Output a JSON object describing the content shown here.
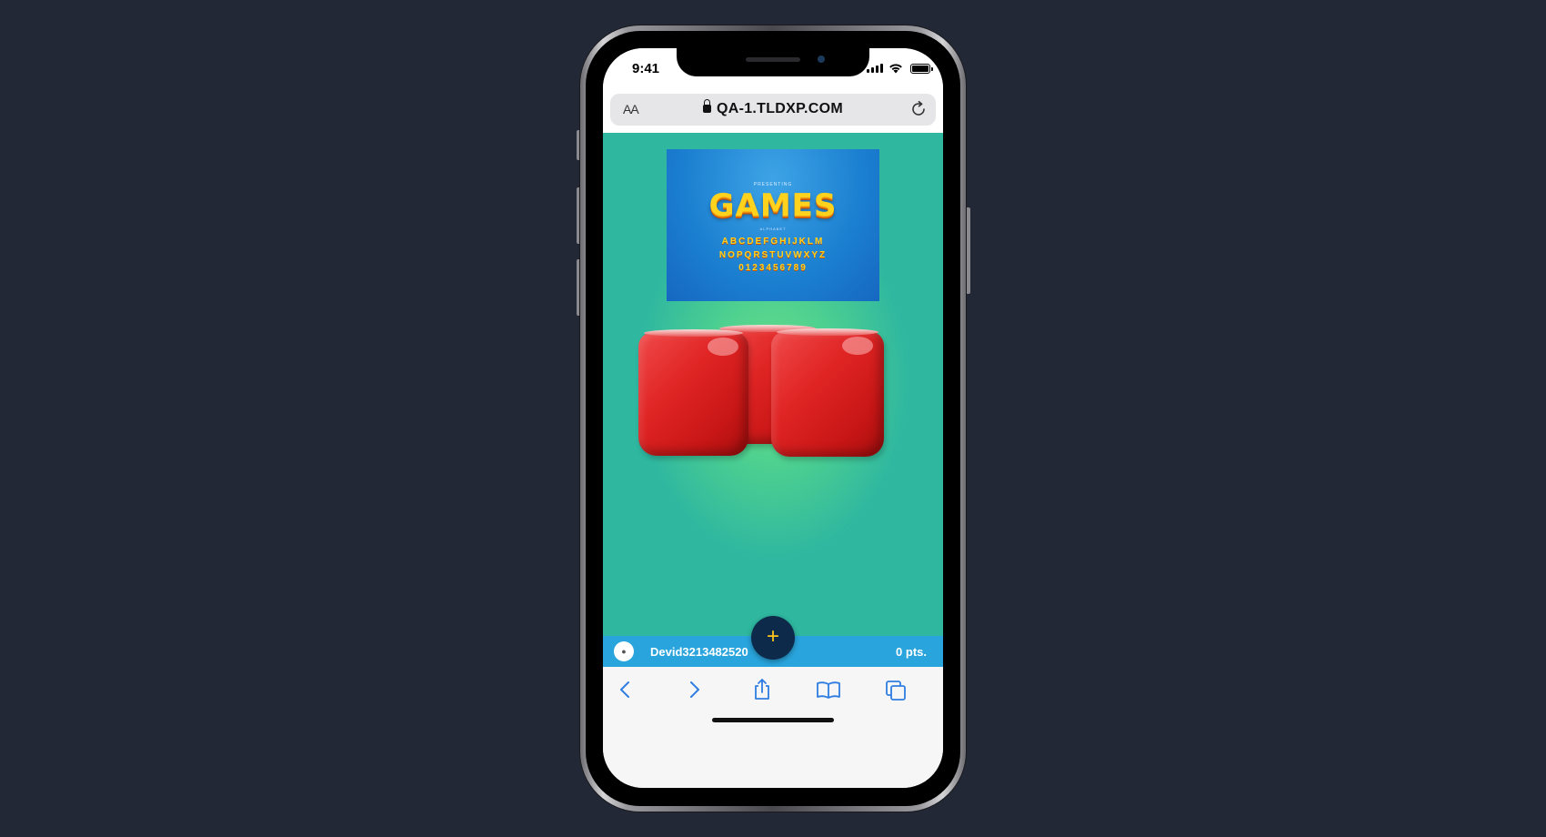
{
  "status_bar": {
    "time": "9:41"
  },
  "browser": {
    "url": "QA-1.TLDXP.COM",
    "text_size_label": "AA"
  },
  "banner": {
    "presenting": "PRESENTING",
    "title": "GAMES",
    "subtitle": "ALPHABET",
    "line1": "ABCDEFGHIJKLM",
    "line2": "NOPQRSTUVWXYZ",
    "line3": "0123456789"
  },
  "player": {
    "avatar_icon": "user-icon",
    "name": "Devid3213482520",
    "points": "0 pts."
  },
  "add_button": {
    "label": "+"
  },
  "toolbar": {
    "icons": [
      "back-icon",
      "forward-icon",
      "share-icon",
      "bookmarks-icon",
      "tabs-icon"
    ]
  },
  "colors": {
    "background": "#222836",
    "content_green": "#4fd18f",
    "player_bar": "#29a4dc",
    "add_button": "#0d2a4a",
    "add_button_plus": "#ffc61a",
    "cup_red": "#e02424",
    "banner_blue": "#1b7fd0",
    "banner_title": "#ffd21e"
  }
}
